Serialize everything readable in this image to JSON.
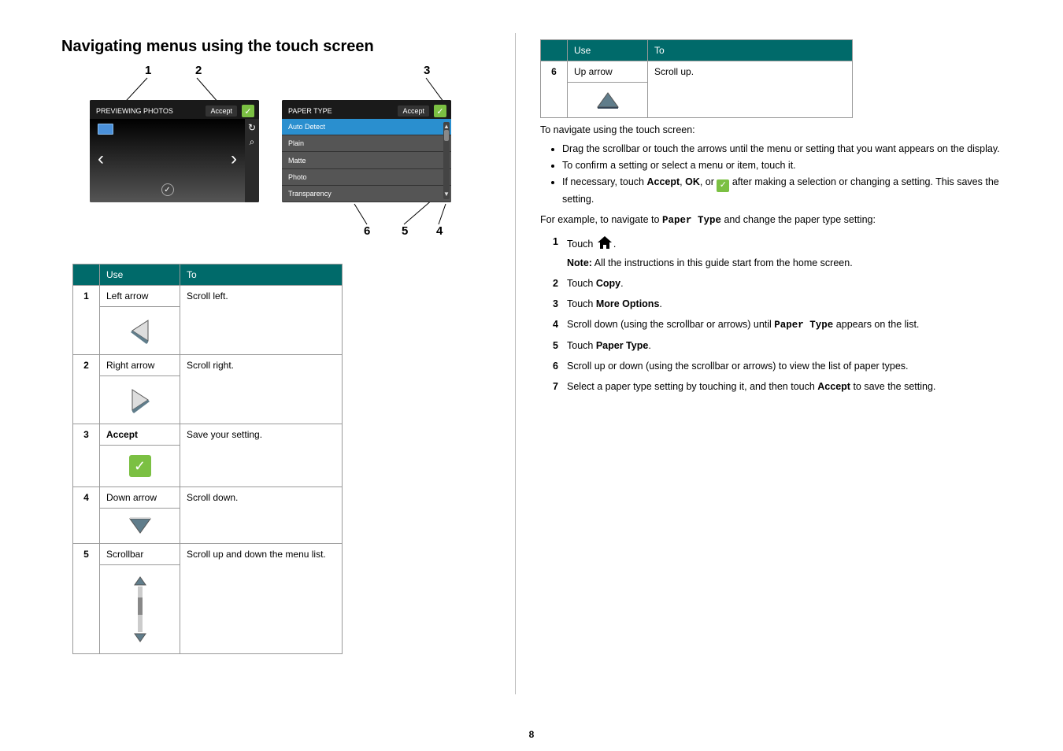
{
  "title": "Navigating menus using the touch screen",
  "callouts": {
    "c1": "1",
    "c2": "2",
    "c3": "3",
    "c4": "4",
    "c5": "5",
    "c6": "6"
  },
  "screen1": {
    "title": "PREVIEWING PHOTOS",
    "accept": "Accept"
  },
  "screen2": {
    "title": "PAPER TYPE",
    "accept": "Accept",
    "items": [
      "Auto Detect",
      "Plain",
      "Matte",
      "Photo",
      "Transparency"
    ]
  },
  "table_header": {
    "use": "Use",
    "to": "To"
  },
  "rows": [
    {
      "n": "1",
      "use": "Left arrow",
      "to": "Scroll left."
    },
    {
      "n": "2",
      "use": "Right arrow",
      "to": "Scroll right."
    },
    {
      "n": "3",
      "use": "Accept",
      "to": "Save your setting."
    },
    {
      "n": "4",
      "use": "Down arrow",
      "to": "Scroll down."
    },
    {
      "n": "5",
      "use": "Scrollbar",
      "to": "Scroll up and down the menu list."
    }
  ],
  "rows2": [
    {
      "n": "6",
      "use": "Up arrow",
      "to": "Scroll up."
    }
  ],
  "intro": "To navigate using the touch screen:",
  "bullets": [
    "Drag the scrollbar or touch the arrows until the menu or setting that you want appears on the display.",
    "To confirm a setting or select a menu or item, touch it."
  ],
  "bullet3_pre": "If necessary, touch ",
  "bullet3_accept": "Accept",
  "bullet3_mid": ", ",
  "bullet3_ok": "OK",
  "bullet3_mid2": ", or ",
  "bullet3_post": " after making a selection or changing a setting. This saves the setting.",
  "example_pre": "For example, to navigate to ",
  "example_mono": "Paper Type",
  "example_post": " and change the paper type setting:",
  "step1_pre": "Touch ",
  "step1_post": ".",
  "note_label": "Note:",
  "note_text": " All the instructions in this guide start from the home screen.",
  "step2_pre": "Touch ",
  "step2_bold": "Copy",
  "step2_post": ".",
  "step3_pre": "Touch ",
  "step3_bold": "More Options",
  "step3_post": ".",
  "step4_pre": "Scroll down (using the scrollbar or arrows) until ",
  "step4_mono": "Paper Type",
  "step4_post": " appears on the list.",
  "step5_pre": "Touch ",
  "step5_bold": "Paper Type",
  "step5_post": ".",
  "step6": "Scroll up or down (using the scrollbar or arrows) to view the list of paper types.",
  "step7_pre": "Select a paper type setting by touching it, and then touch ",
  "step7_bold": "Accept",
  "step7_post": " to save the setting.",
  "pagenum": "8"
}
